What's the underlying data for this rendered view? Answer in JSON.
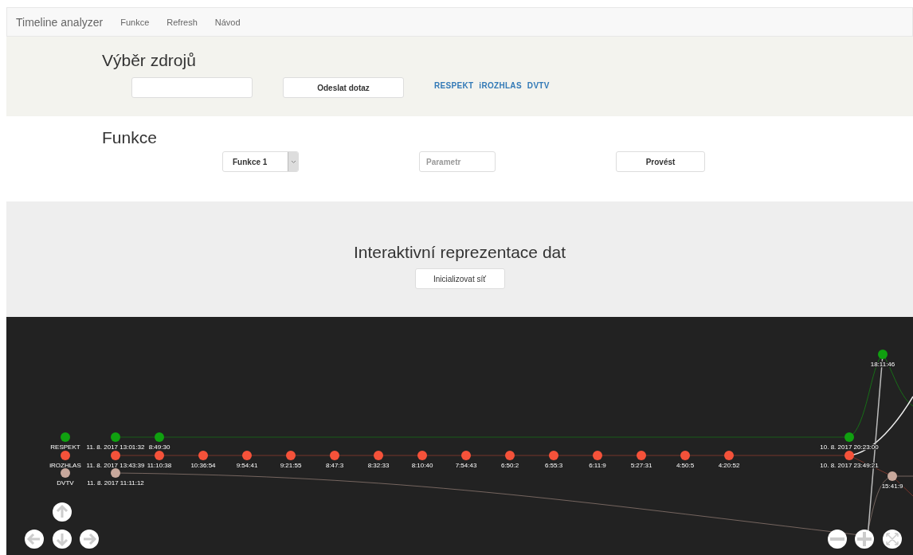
{
  "navbar": {
    "brand": "Timeline analyzer",
    "links": [
      "Funkce",
      "Refresh",
      "Návod"
    ]
  },
  "sources": {
    "title": "Výběr zdrojů",
    "button": "Odeslat dotaz",
    "tags": [
      "RESPEKT",
      "iROZHLAS",
      "DVTV"
    ]
  },
  "functions": {
    "title": "Funkce",
    "select": "Funkce 1",
    "parameter": {
      "placeholder": "Parametr"
    },
    "button": "Provést"
  },
  "interactive": {
    "title": "Interaktivní reprezentace dat",
    "button": "Inicializovat síť"
  },
  "network": {
    "series": [
      {
        "name": "RESPEKT",
        "color": "#10a010",
        "nodes": [
          "11. 8. 2017 13:01:32",
          "8:49:30",
          "10. 8. 2017 20:23:00",
          "18:11:46"
        ]
      },
      {
        "name": "iROZHLAS",
        "color": "#f5523a",
        "nodes": [
          "11. 8. 2017 13:43:39",
          "11:10:38",
          "10:36:54",
          "9:54:41",
          "9:21:55",
          "8:47:3",
          "8:32:33",
          "8:10:40",
          "7:54:43",
          "6:50:2",
          "6:55:3",
          "6:11:9",
          "5:27:31",
          "4:50:5",
          "4:20:52",
          "10. 8. 2017 23:49:21"
        ]
      },
      {
        "name": "DVTV",
        "color": "#c8a89c",
        "nodes": [
          "11. 8. 2017 11:11:12",
          "15:41:9"
        ]
      }
    ]
  }
}
